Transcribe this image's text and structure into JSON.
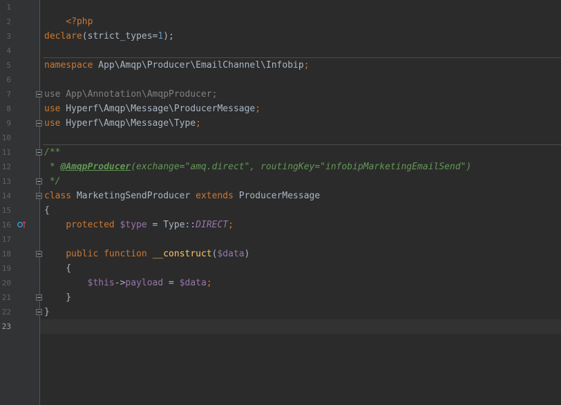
{
  "colors": {
    "editor_bg": "#2b2b2b",
    "gutter_bg": "#313335",
    "keyword": "#cc7832",
    "function_name": "#ffc66d",
    "variable": "#9876aa",
    "number": "#6897bb",
    "docblock": "#629755",
    "text": "#a9b7c6",
    "unused_import": "#808080",
    "line_number": "#606366",
    "implements_marker": "#3592c4",
    "overrides_marker": "#c93b48"
  },
  "editor": {
    "current_line": "23",
    "line_numbers": [
      "1",
      "2",
      "3",
      "4",
      "5",
      "6",
      "7",
      "8",
      "9",
      "10",
      "11",
      "12",
      "13",
      "14",
      "15",
      "16",
      "17",
      "18",
      "19",
      "20",
      "21",
      "22",
      "23"
    ],
    "code": {
      "l1_open_tag": "<?php",
      "l3_declare": "declare",
      "l3_open": "(strict_types=",
      "l3_one": "1",
      "l3_close": ");",
      "l5_namespace_kw": "namespace",
      "l5_namespace_name": " App\\Amqp\\Producer\\EmailChannel\\Infobip",
      "l5_semicolon": ";",
      "l7_use_kw": "use",
      "l7_path": " App\\Annotation\\AmqpProducer",
      "l7_semicolon": ";",
      "l8_use_kw": "use",
      "l8_path": " Hyperf\\Amqp\\Message\\ProducerMessage",
      "l8_semicolon": ";",
      "l9_use_kw": "use",
      "l9_path": " Hyperf\\Amqp\\Message\\Type",
      "l9_semicolon": ";",
      "l11_doc_open": "/**",
      "l12_doc_star": " * ",
      "l12_annotation": "@AmqpProducer",
      "l12_params": "(exchange=\"amq.direct\", routingKey=\"infobipMarketingEmailSend\")",
      "l13_doc_close": " */",
      "l14_class_kw": "class",
      "l14_class_name": " MarketingSendProducer ",
      "l14_extends_kw": "extends",
      "l14_parent": " ProducerMessage",
      "l15_brace": "{",
      "l16_indent": "    ",
      "l16_protected_kw": "protected",
      "l16_space": " ",
      "l16_var": "$type",
      "l16_assign": " = Type::",
      "l16_const": "DIRECT",
      "l16_semicolon": ";",
      "l18_indent": "    ",
      "l18_public_kw": "public",
      "l18_space": " ",
      "l18_function_kw": "function",
      "l18_space2": " ",
      "l18_fn_name": "__construct",
      "l18_paren_open": "(",
      "l18_param": "$data",
      "l18_paren_close": ")",
      "l19_brace": "    {",
      "l20_indent": "        ",
      "l20_this": "$this",
      "l20_arrow": "->",
      "l20_prop": "payload",
      "l20_assign": " = ",
      "l20_data": "$data",
      "l20_semicolon": ";",
      "l21_brace": "    }",
      "l22_brace": "}"
    }
  }
}
